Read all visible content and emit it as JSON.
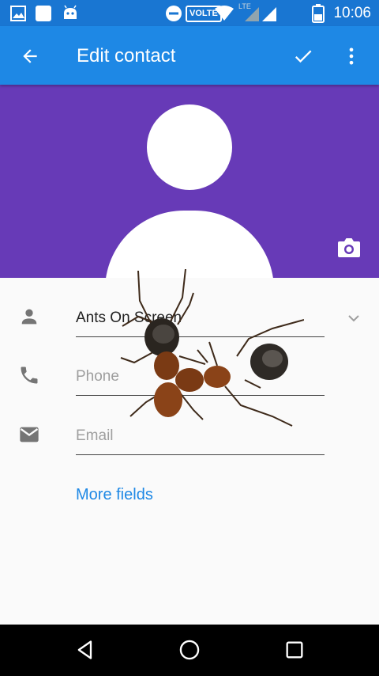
{
  "status_bar": {
    "time": "10:06",
    "volte_label": "VOLTE",
    "lte_label": "LTE",
    "icons": [
      "gallery-icon",
      "app-square-icon",
      "android-icon",
      "dnd-icon",
      "wifi-icon",
      "signal-icon",
      "signal-icon",
      "battery-icon"
    ]
  },
  "app_bar": {
    "title": "Edit contact",
    "back_icon": "arrow-back-icon",
    "save_icon": "check-icon",
    "menu_icon": "more-vert-icon"
  },
  "photo": {
    "background_color": "#673ab7",
    "camera_icon": "camera-icon"
  },
  "fields": {
    "name": {
      "value": "Ants On Screen",
      "icon": "person-icon",
      "expand_icon": "chevron-down-icon"
    },
    "phone": {
      "placeholder": "Phone",
      "icon": "phone-icon"
    },
    "email": {
      "placeholder": "Email",
      "icon": "email-icon"
    }
  },
  "more_fields_label": "More fields",
  "nav_bar": {
    "back": "nav-back-icon",
    "home": "nav-home-icon",
    "recents": "nav-recents-icon"
  },
  "colors": {
    "app_bar": "#1e88e5",
    "status_bar": "#1976d2",
    "accent": "#1e88e5"
  }
}
